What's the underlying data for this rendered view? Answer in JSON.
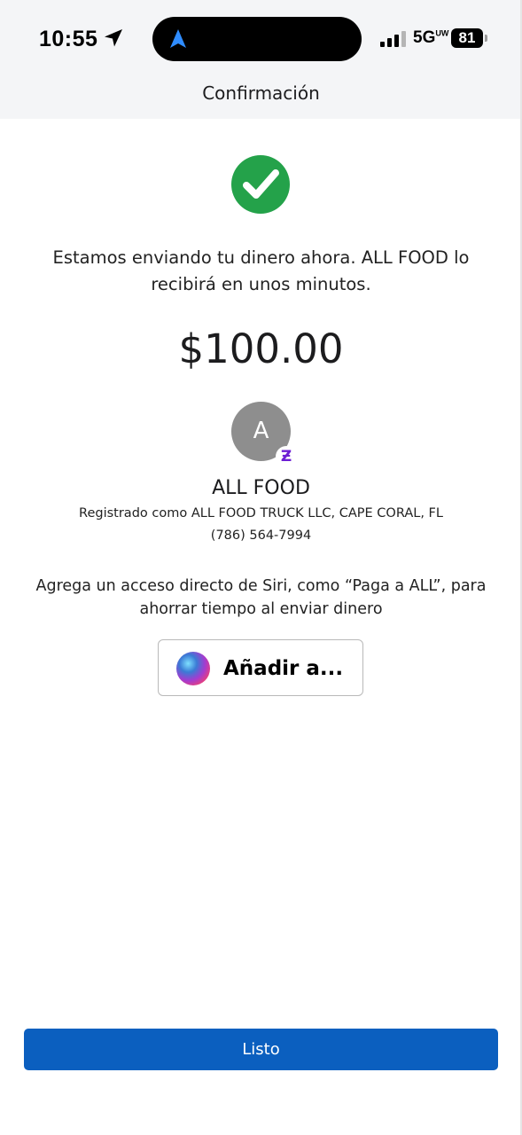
{
  "status_bar": {
    "time": "10:55",
    "network": "5G",
    "network_suffix": "UW",
    "battery": "81"
  },
  "header": {
    "title": "Confirmación"
  },
  "confirmation": {
    "message": "Estamos enviando tu dinero ahora. ALL FOOD lo recibirá en unos minutos.",
    "amount": "$100.00"
  },
  "recipient": {
    "initial": "A",
    "badge": "Ƶ",
    "name": "ALL FOOD",
    "registered": "Registrado como ALL FOOD TRUCK LLC, CAPE CORAL, FL",
    "phone": "(786) 564-7994"
  },
  "siri": {
    "prompt": "Agrega un acceso directo de Siri, como “Paga a ALL”, para ahorrar tiempo al enviar dinero",
    "button_label": "Añadir a..."
  },
  "footer": {
    "done_label": "Listo"
  },
  "colors": {
    "success_green": "#24a24a",
    "primary_blue": "#0b5fbf",
    "zelle_purple": "#6d1ed4",
    "avatar_gray": "#8e8e8e"
  }
}
